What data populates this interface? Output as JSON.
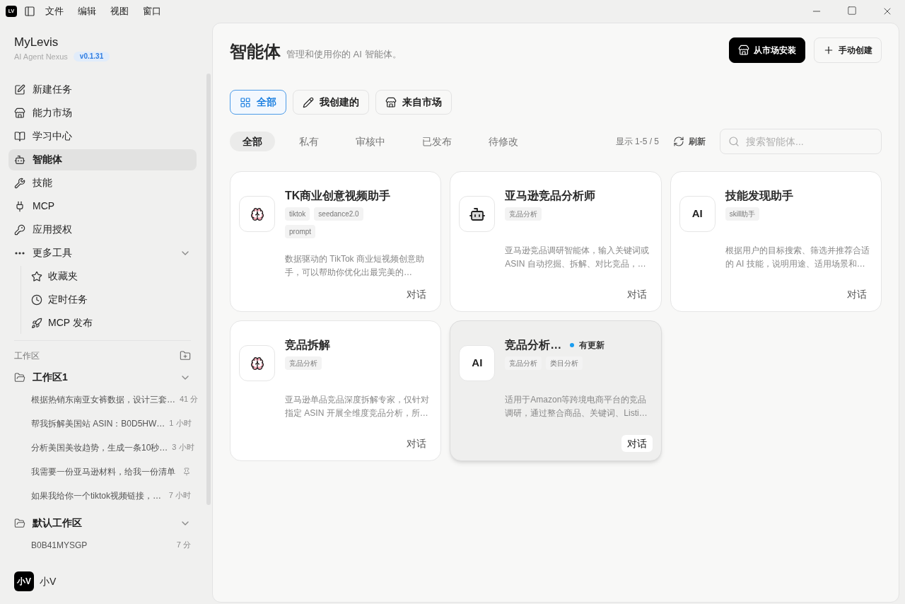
{
  "titlebar": {
    "app_icon": "LV",
    "menu": [
      "文件",
      "编辑",
      "视图",
      "窗口"
    ]
  },
  "sidebar": {
    "brand": {
      "name": "MyLevis",
      "subtitle": "AI Agent Nexus",
      "version": "v0.1.31"
    },
    "nav": [
      {
        "label": "新建任务",
        "selected": false
      },
      {
        "label": "能力市场",
        "selected": false
      },
      {
        "label": "学习中心",
        "selected": false
      },
      {
        "label": "智能体",
        "selected": true
      },
      {
        "label": "技能",
        "selected": false
      },
      {
        "label": "MCP",
        "selected": false
      },
      {
        "label": "应用授权",
        "selected": false
      }
    ],
    "more_tools": {
      "label": "更多工具",
      "expanded": true,
      "children": [
        {
          "label": "收藏夹"
        },
        {
          "label": "定时任务"
        },
        {
          "label": "MCP 发布"
        }
      ]
    },
    "workspace_header": "工作区",
    "workspaces": [
      {
        "name": "工作区1",
        "expanded": true,
        "tasks": [
          {
            "title": "根据热销东南亚女裤数据，设计三套…",
            "time": "41 分",
            "pinned": false
          },
          {
            "title": "帮我拆解美国站 ASIN：B0D5HW…",
            "time": "1 小时",
            "pinned": false
          },
          {
            "title": "分析美国美妆趋势，生成一条10秒…",
            "time": "3 小时",
            "pinned": false
          },
          {
            "title": "我需要一份亚马逊材料，给我一份清单",
            "pinned": true
          },
          {
            "title": "如果我给你一个tiktok视频链接，…",
            "time": "7 小时",
            "pinned": false
          }
        ]
      },
      {
        "name": "默认工作区",
        "expanded": true,
        "tasks": [
          {
            "title": "B0B41MYSGP",
            "time": "7 分",
            "pinned": false
          }
        ]
      }
    ],
    "user": {
      "avatar": "小V",
      "name": "小V"
    }
  },
  "main": {
    "title": "智能体",
    "subtitle": "管理和使用你的 AI 智能体。",
    "actions": [
      {
        "label": "从市场安装",
        "kind": "primary"
      },
      {
        "label": "手动创建",
        "kind": "secondary"
      }
    ],
    "source_tabs": [
      {
        "label": "全部",
        "selected": true
      },
      {
        "label": "我创建的",
        "selected": false
      },
      {
        "label": "来自市场",
        "selected": false
      }
    ],
    "status_tabs": [
      {
        "label": "全部",
        "selected": true
      },
      {
        "label": "私有",
        "selected": false
      },
      {
        "label": "审核中",
        "selected": false
      },
      {
        "label": "已发布",
        "selected": false
      },
      {
        "label": "待修改",
        "selected": false
      }
    ],
    "count": "显示 1-5 / 5",
    "refresh": "刷新",
    "search": {
      "placeholder": "搜索智能体..."
    },
    "agents": [
      {
        "name": "TK商业创意视频助手",
        "avatar": {
          "kind": "brain"
        },
        "tags": [
          "tiktok",
          "seedance2.0",
          "prompt"
        ],
        "description": "数据驱动的 TikTok 商业短视频创意助手，可以帮助你优化出最完美的…",
        "action": "对话",
        "hovered": false
      },
      {
        "name": "亚马逊竞品分析师",
        "avatar": {
          "kind": "robot"
        },
        "tags": [
          "竞品分析"
        ],
        "description": "亚马逊竞品调研智能体，输入关键词或 ASIN 自动挖掘、拆解、对比竞品，…",
        "action": "对话",
        "hovered": false
      },
      {
        "name": "技能发现助手",
        "avatar": {
          "kind": "text",
          "text": "AI"
        },
        "tags": [
          "skill助手"
        ],
        "description": "根据用户的目标搜索、筛选并推荐合适的 AI 技能，说明用途、适用场景和…",
        "action": "对话",
        "hovered": false
      },
      {
        "name": "竞品拆解",
        "avatar": {
          "kind": "brain"
        },
        "tags": [
          "竞品分析"
        ],
        "description": "亚马逊单品竞品深度拆解专家，仅针对指定 ASIN 开展全维度竞品分析，所…",
        "action": "对话",
        "hovered": false
      },
      {
        "name": "竞品分析…",
        "avatar": {
          "kind": "text",
          "text": "AI"
        },
        "badge": "有更新",
        "tags": [
          "竞品分析",
          "类目分析"
        ],
        "description": "适用于Amazon等跨境电商平台的竞品调研，通过整合商品、关键词、Listi…",
        "action": "对话",
        "hovered": true
      }
    ]
  }
}
